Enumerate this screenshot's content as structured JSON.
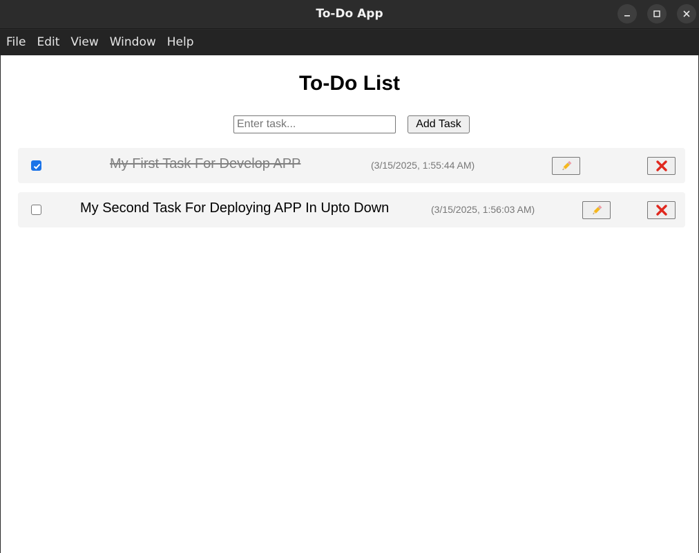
{
  "window": {
    "title": "To-Do App",
    "controls": [
      "minimize-icon",
      "maximize-icon",
      "close-icon"
    ]
  },
  "menu": [
    "File",
    "Edit",
    "View",
    "Window",
    "Help"
  ],
  "page": {
    "heading": "To-Do List",
    "input_placeholder": "Enter task...",
    "input_value": "",
    "add_button": "Add Task"
  },
  "tasks": [
    {
      "text": "My First Task For Develop APP",
      "timestamp": "(3/15/2025, 1:55:44 AM)",
      "completed": true,
      "edit_icon": "pencil-icon",
      "delete_icon": "cross-icon"
    },
    {
      "text": "My Second Task For Deploying APP In Upto Down",
      "timestamp": "(3/15/2025, 1:56:03 AM)",
      "completed": false,
      "edit_icon": "pencil-icon",
      "delete_icon": "cross-icon"
    }
  ],
  "colors": {
    "checkbox_checked": "#1a73e8",
    "delete_icon": "#e0281e",
    "completed_text": "#808080"
  }
}
